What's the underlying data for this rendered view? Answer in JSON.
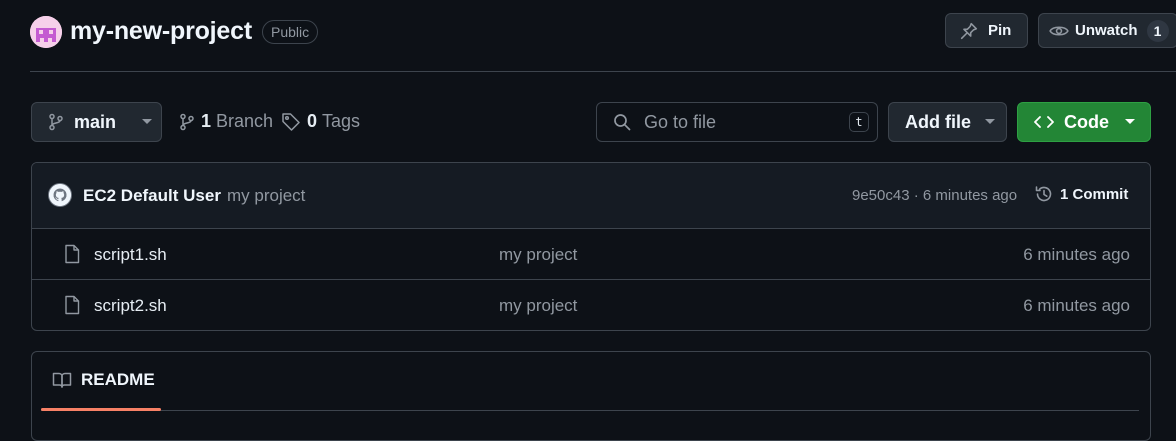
{
  "header": {
    "repo_name": "my-new-project",
    "visibility": "Public",
    "pin_label": "Pin",
    "unwatch_label": "Unwatch",
    "watch_count": "1"
  },
  "toolbar": {
    "branch": "main",
    "branch_count": "1",
    "branch_label": "Branch",
    "tag_count": "0",
    "tag_label": "Tags",
    "search_placeholder": "Go to file",
    "search_shortcut": "t",
    "add_file_label": "Add file",
    "code_label": "Code"
  },
  "commit": {
    "author": "EC2 Default User",
    "message": "my project",
    "hash_time": "9e50c43 · 6 minutes ago",
    "count_label": "1 Commit"
  },
  "files": [
    {
      "name": "script1.sh",
      "message": "my project",
      "time": "6 minutes ago"
    },
    {
      "name": "script2.sh",
      "message": "my project",
      "time": "6 minutes ago"
    }
  ],
  "readme": {
    "tab_label": "README"
  },
  "colors": {
    "background": "#0d1117",
    "code_button": "#238636",
    "readme_underline": "#f78166"
  },
  "icons": [
    "avatar-identicon",
    "pin-icon",
    "eye-icon",
    "git-branch-icon",
    "tag-icon",
    "search-icon",
    "code-icon",
    "chevron-down-icon",
    "history-icon",
    "file-icon",
    "book-icon"
  ]
}
